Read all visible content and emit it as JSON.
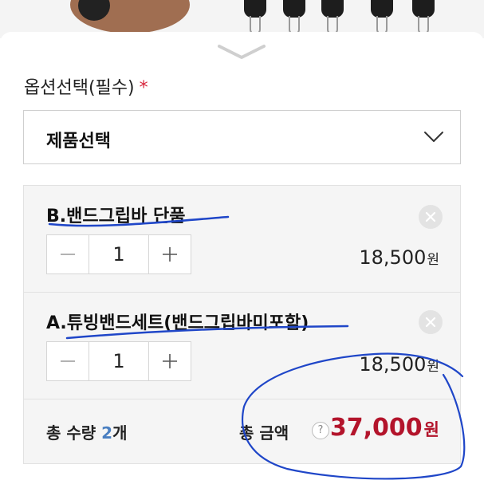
{
  "option_section": {
    "title": "옵션선택(필수)",
    "required_mark": "*"
  },
  "select": {
    "label": "제품선택",
    "arrow_icon": "chevron-down-icon"
  },
  "items": [
    {
      "name": "B.밴드그립바 단품",
      "quantity": "1",
      "price": "18,500",
      "currency": "원"
    },
    {
      "name": "A.튜빙밴드세트(밴드그립바미포함)",
      "quantity": "1",
      "price": "18,500",
      "currency": "원"
    }
  ],
  "summary": {
    "qty_label": "총 수량",
    "qty_value": "2",
    "qty_unit": "개",
    "amount_label": "총 금액",
    "help_glyph": "?",
    "amount_value": "37,000",
    "amount_currency": "원"
  },
  "colors": {
    "required": "#d7263d",
    "total_price": "#b3142b",
    "total_count": "#4a7fc1",
    "annotation_pen": "#1f46c8"
  }
}
